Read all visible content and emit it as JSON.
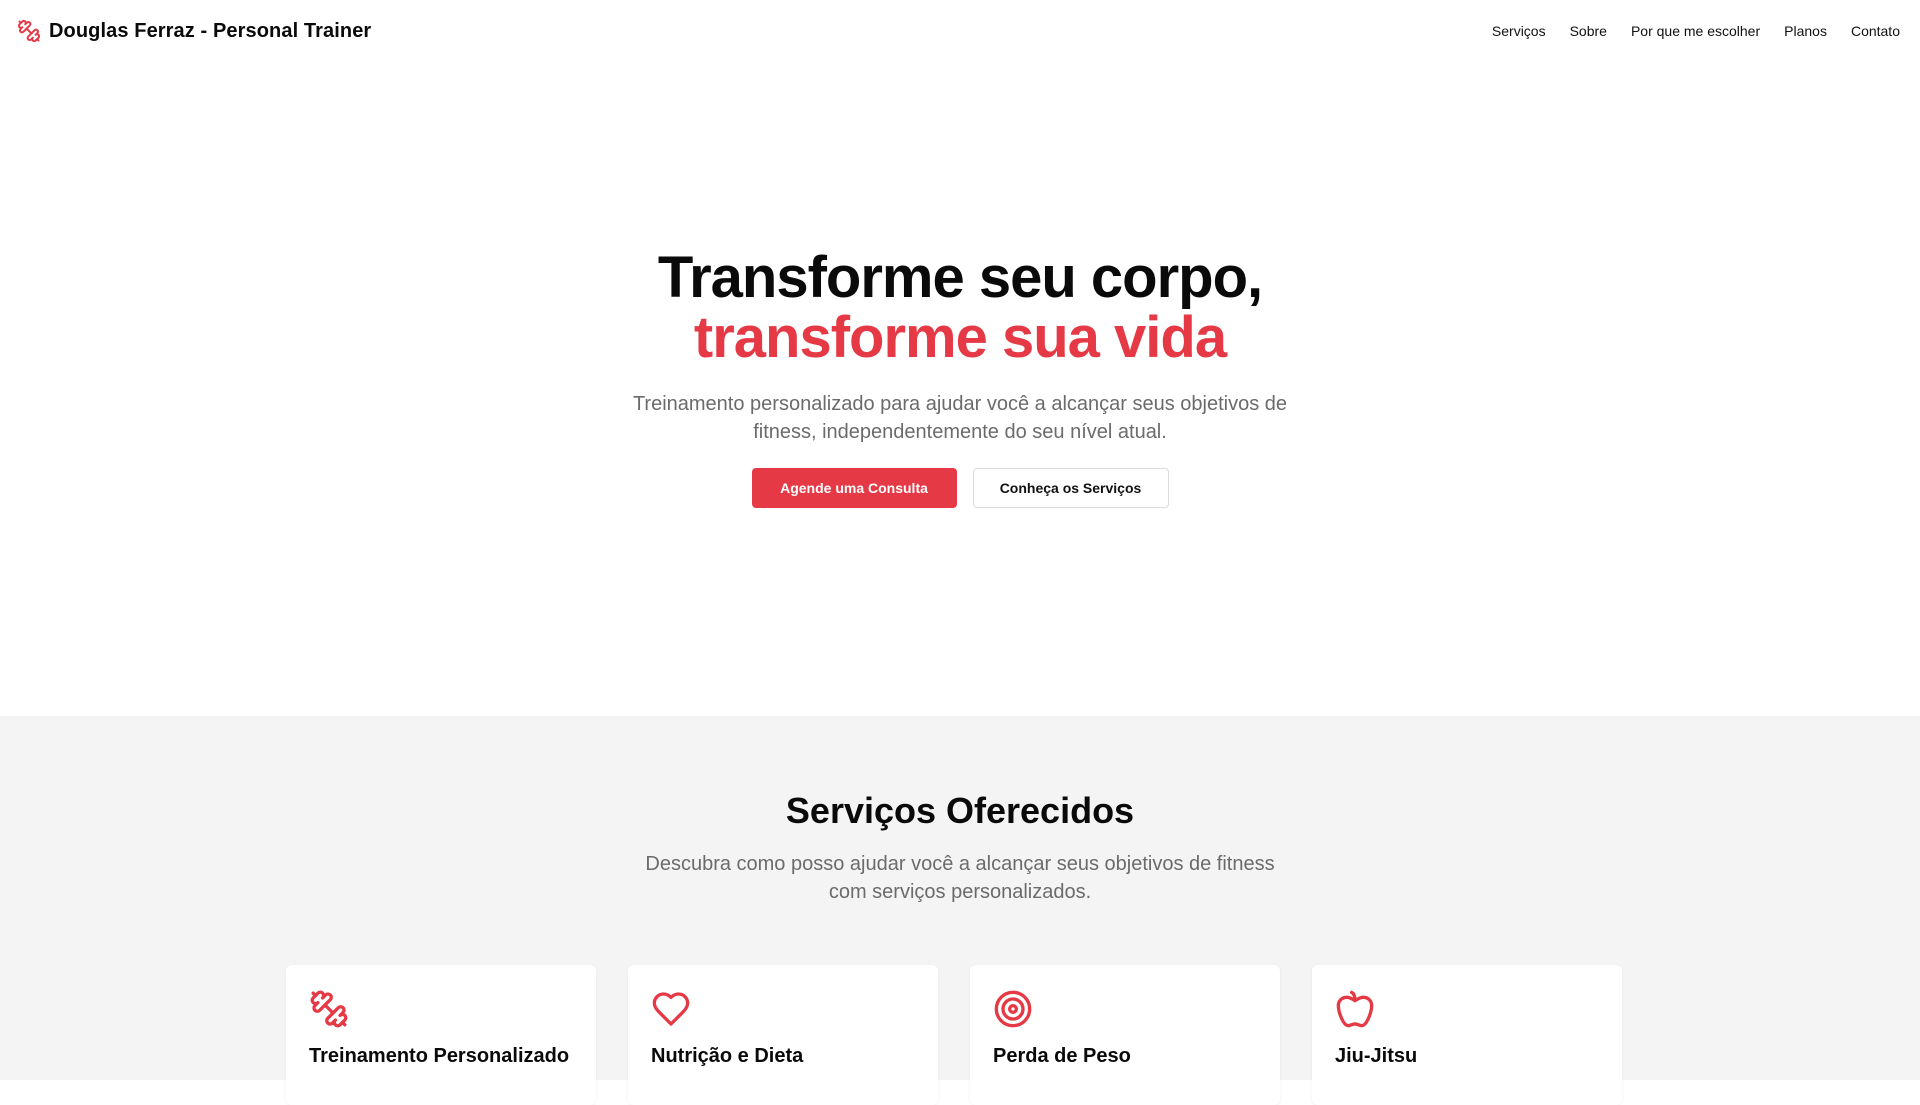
{
  "brand": {
    "title": "Douglas Ferraz - Personal Trainer",
    "icon": "dumbbell-icon",
    "accent_color": "#e63946"
  },
  "nav": {
    "items": [
      {
        "label": "Serviços"
      },
      {
        "label": "Sobre"
      },
      {
        "label": "Por que me escolher"
      },
      {
        "label": "Planos"
      },
      {
        "label": "Contato"
      }
    ]
  },
  "hero": {
    "title_line1": "Transforme seu corpo,",
    "title_line2": "transforme sua vida",
    "subtitle": "Treinamento personalizado para ajudar você a alcançar seus objetivos de fitness, independentemente do seu nível atual.",
    "primary_button": "Agende uma Consulta",
    "secondary_button": "Conheça os Serviços"
  },
  "services": {
    "title": "Serviços Oferecidos",
    "subtitle": "Descubra como posso ajudar você a alcançar seus objetivos de fitness com serviços personalizados.",
    "cards": [
      {
        "title": "Treinamento Personalizado",
        "icon": "dumbbell-icon"
      },
      {
        "title": "Nutrição e Dieta",
        "icon": "heart-icon"
      },
      {
        "title": "Perda de Peso",
        "icon": "target-icon"
      },
      {
        "title": "Jiu-Jitsu",
        "icon": "apple-icon"
      }
    ]
  }
}
